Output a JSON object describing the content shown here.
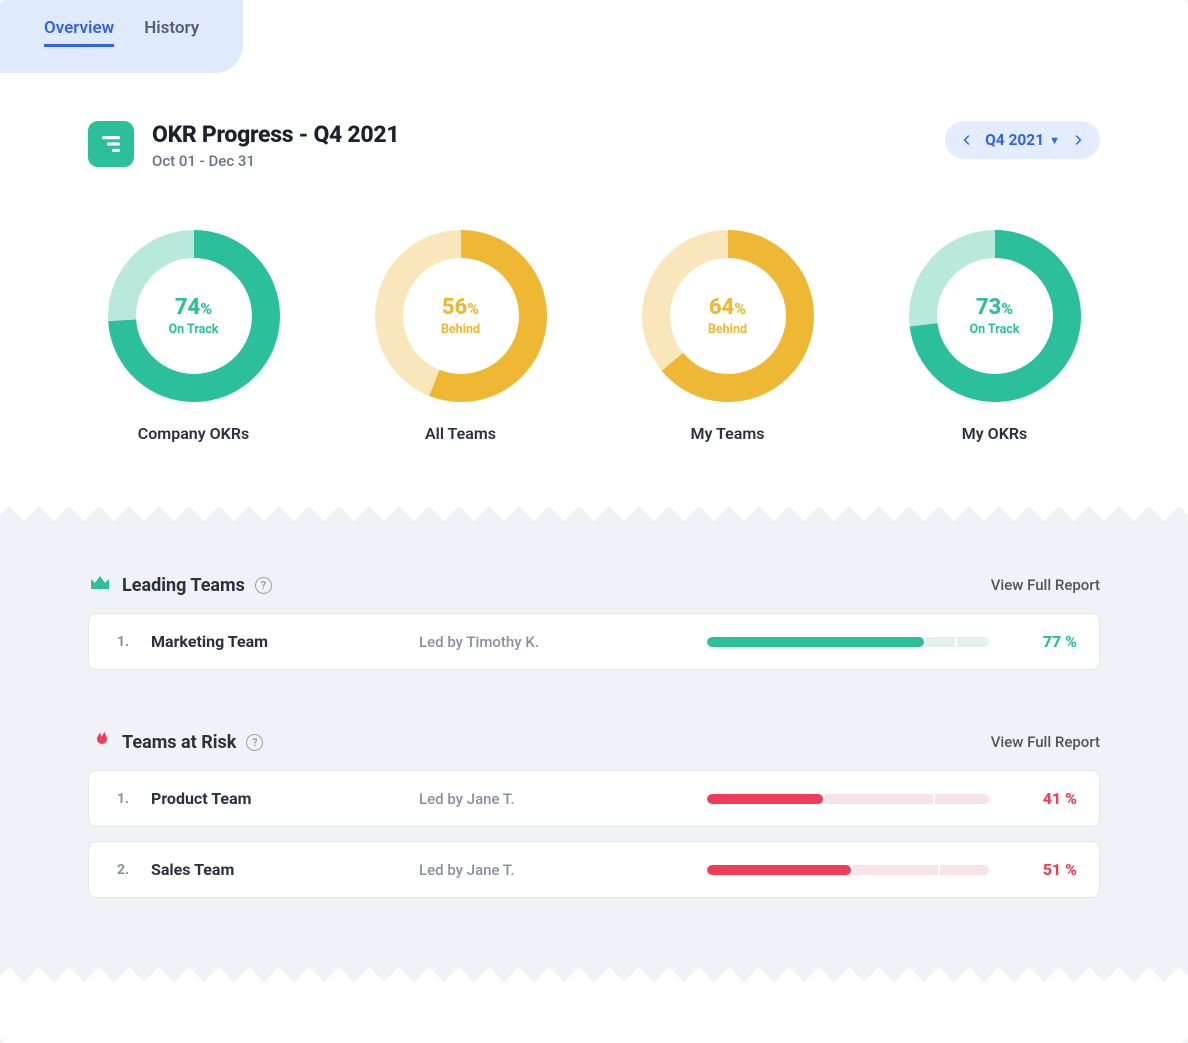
{
  "tabs": {
    "overview": "Overview",
    "history": "History"
  },
  "header": {
    "title": "OKR Progress - Q4 2021",
    "date_range": "Oct 01 - Dec 31",
    "period_label": "Q4 2021"
  },
  "colors": {
    "green": "#2bbf9b",
    "green_light": "#b8e9db",
    "yellow": "#eeb734",
    "yellow_light": "#f9e6bb",
    "red": "#ef3d58",
    "red_light": "#f9c0ca",
    "blue": "#3064e6"
  },
  "chart_data": [
    {
      "type": "pie",
      "title": "Company OKRs",
      "value": 74,
      "status": "On Track",
      "color": "green"
    },
    {
      "type": "pie",
      "title": "All Teams",
      "value": 56,
      "status": "Behind",
      "color": "yellow"
    },
    {
      "type": "pie",
      "title": "My Teams",
      "value": 64,
      "status": "Behind",
      "color": "yellow"
    },
    {
      "type": "pie",
      "title": "My OKRs",
      "value": 73,
      "status": "On Track",
      "color": "green"
    }
  ],
  "leading": {
    "heading": "Leading Teams",
    "view_link": "View Full Report",
    "rows": [
      {
        "rank": "1.",
        "name": "Marketing Team",
        "lead": "Led by Timothy K.",
        "pct": 77,
        "bar_secondary": 88,
        "pct_text": "77 %"
      }
    ]
  },
  "risk": {
    "heading": "Teams at Risk",
    "view_link": "View Full Report",
    "rows": [
      {
        "rank": "1.",
        "name": "Product Team",
        "lead": "Led by Jane T.",
        "pct": 41,
        "bar_secondary": 80,
        "pct_text": "41 %"
      },
      {
        "rank": "2.",
        "name": "Sales Team",
        "lead": "Led by Jane T.",
        "pct": 51,
        "bar_secondary": 82,
        "pct_text": "51 %"
      }
    ]
  }
}
